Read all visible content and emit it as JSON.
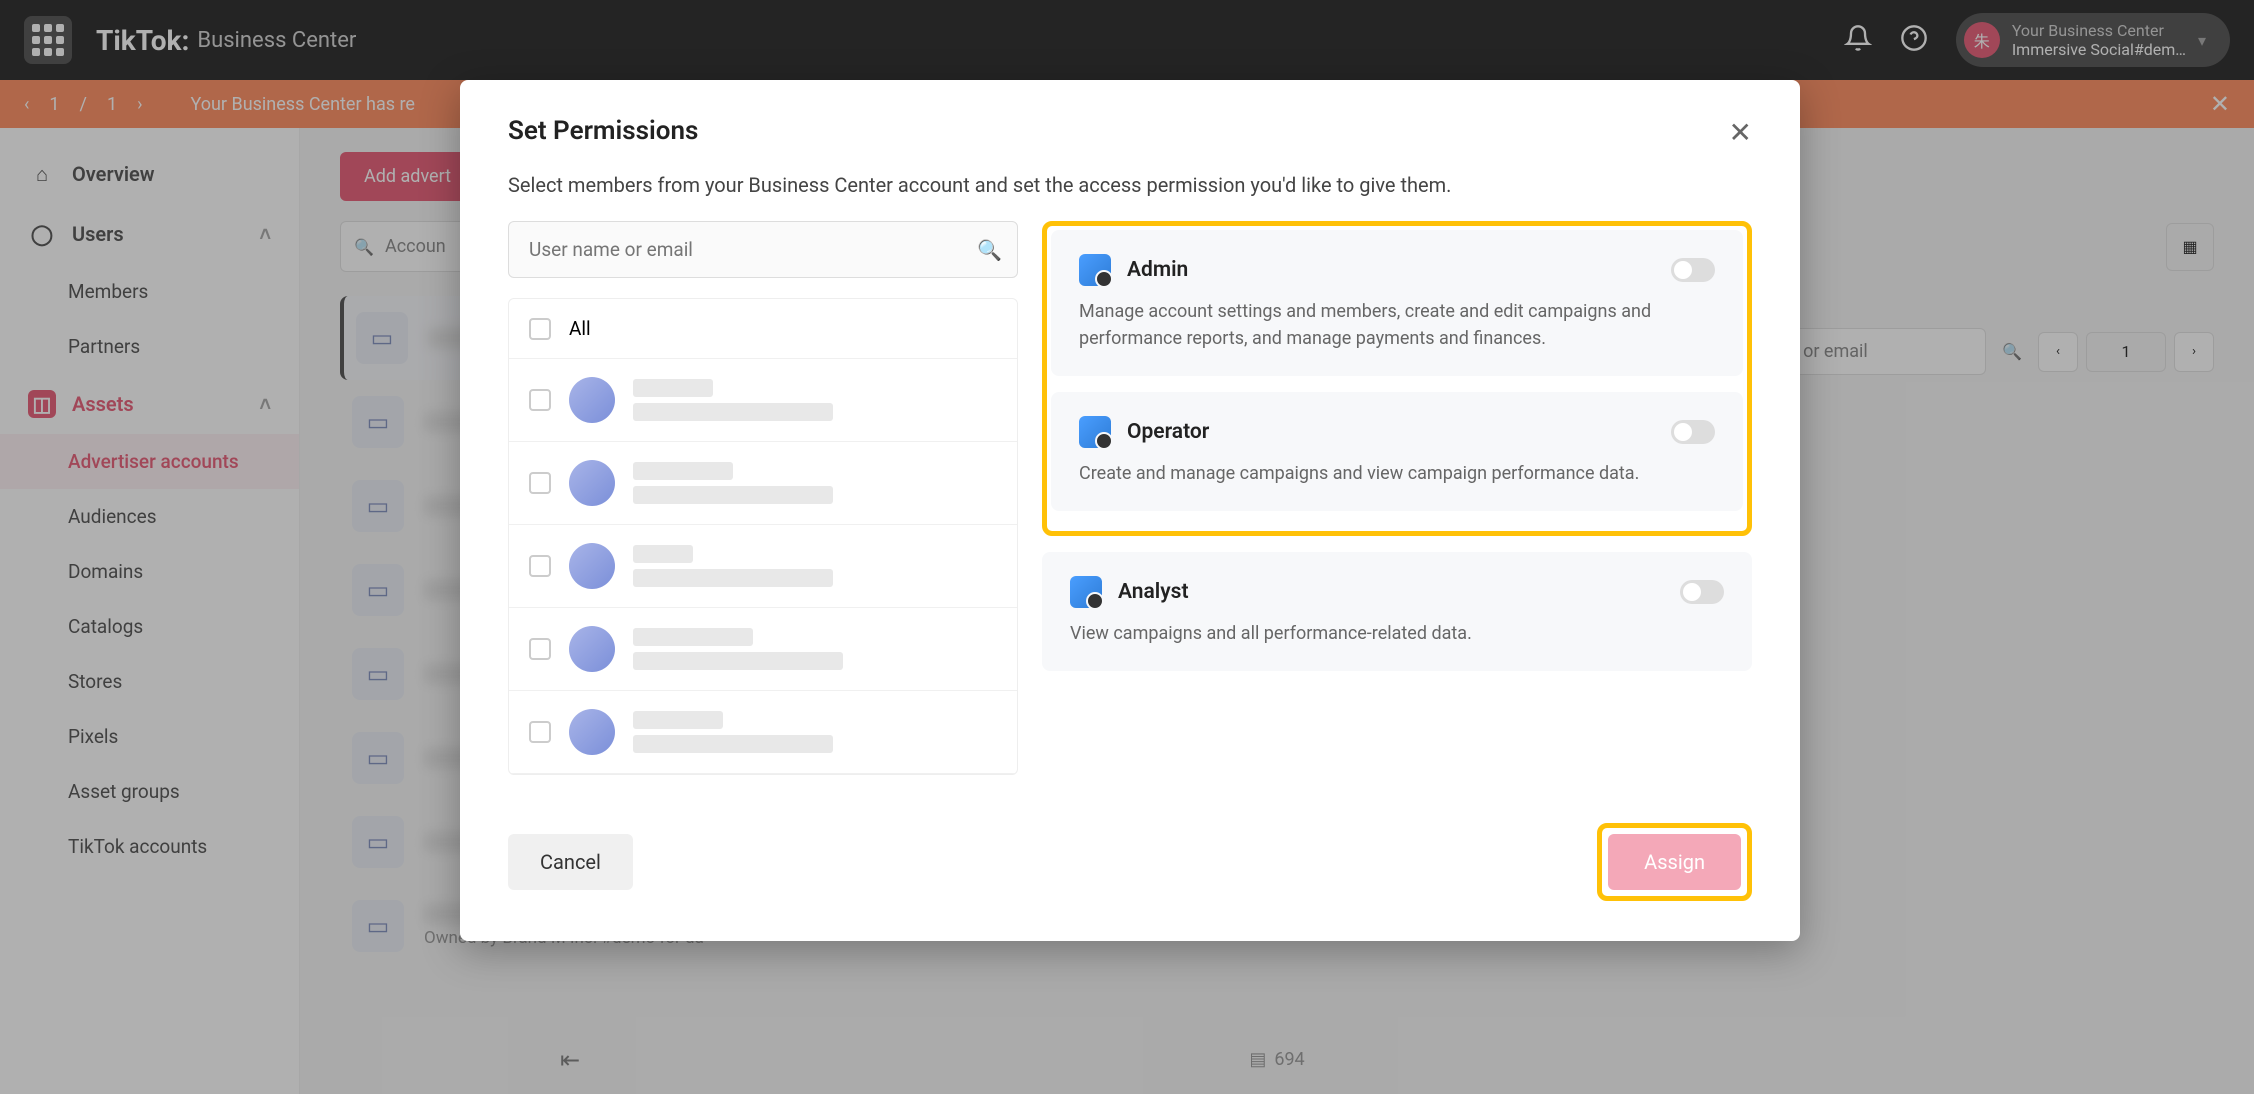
{
  "topbar": {
    "logo": "TikTok:",
    "product": "Business Center",
    "account_label": "Your Business Center",
    "account_name": "Immersive Social#dem…",
    "avatar_char": "朱"
  },
  "banner": {
    "page_current": "1",
    "page_sep": "/",
    "page_total": "1",
    "message": "Your Business Center has re"
  },
  "sidebar": {
    "overview": "Overview",
    "users": "Users",
    "members": "Members",
    "partners": "Partners",
    "assets": "Assets",
    "advertiser_accounts": "Advertiser accounts",
    "audiences": "Audiences",
    "domains": "Domains",
    "catalogs": "Catalogs",
    "stores": "Stores",
    "pixels": "Pixels",
    "asset_groups": "Asset groups",
    "tiktok_accounts": "TikTok accounts"
  },
  "main": {
    "add_button": "Add advert",
    "search_placeholder": "Accoun",
    "owner_line": "Owned by Brand M Inc. #demo for da",
    "footer_count": "694",
    "right_search_placeholder": "or email",
    "page_num": "1"
  },
  "modal": {
    "title": "Set Permissions",
    "subtitle": "Select members from your Business Center account and set the access permission you'd like to give them.",
    "search_placeholder": "User name or email",
    "all_label": "All",
    "roles": {
      "admin": {
        "title": "Admin",
        "desc": "Manage account settings and members, create and edit campaigns and performance reports, and manage payments and finances."
      },
      "operator": {
        "title": "Operator",
        "desc": "Create and manage campaigns and view campaign performance data."
      },
      "analyst": {
        "title": "Analyst",
        "desc": "View campaigns and all performance-related data."
      }
    },
    "cancel": "Cancel",
    "assign": "Assign"
  }
}
